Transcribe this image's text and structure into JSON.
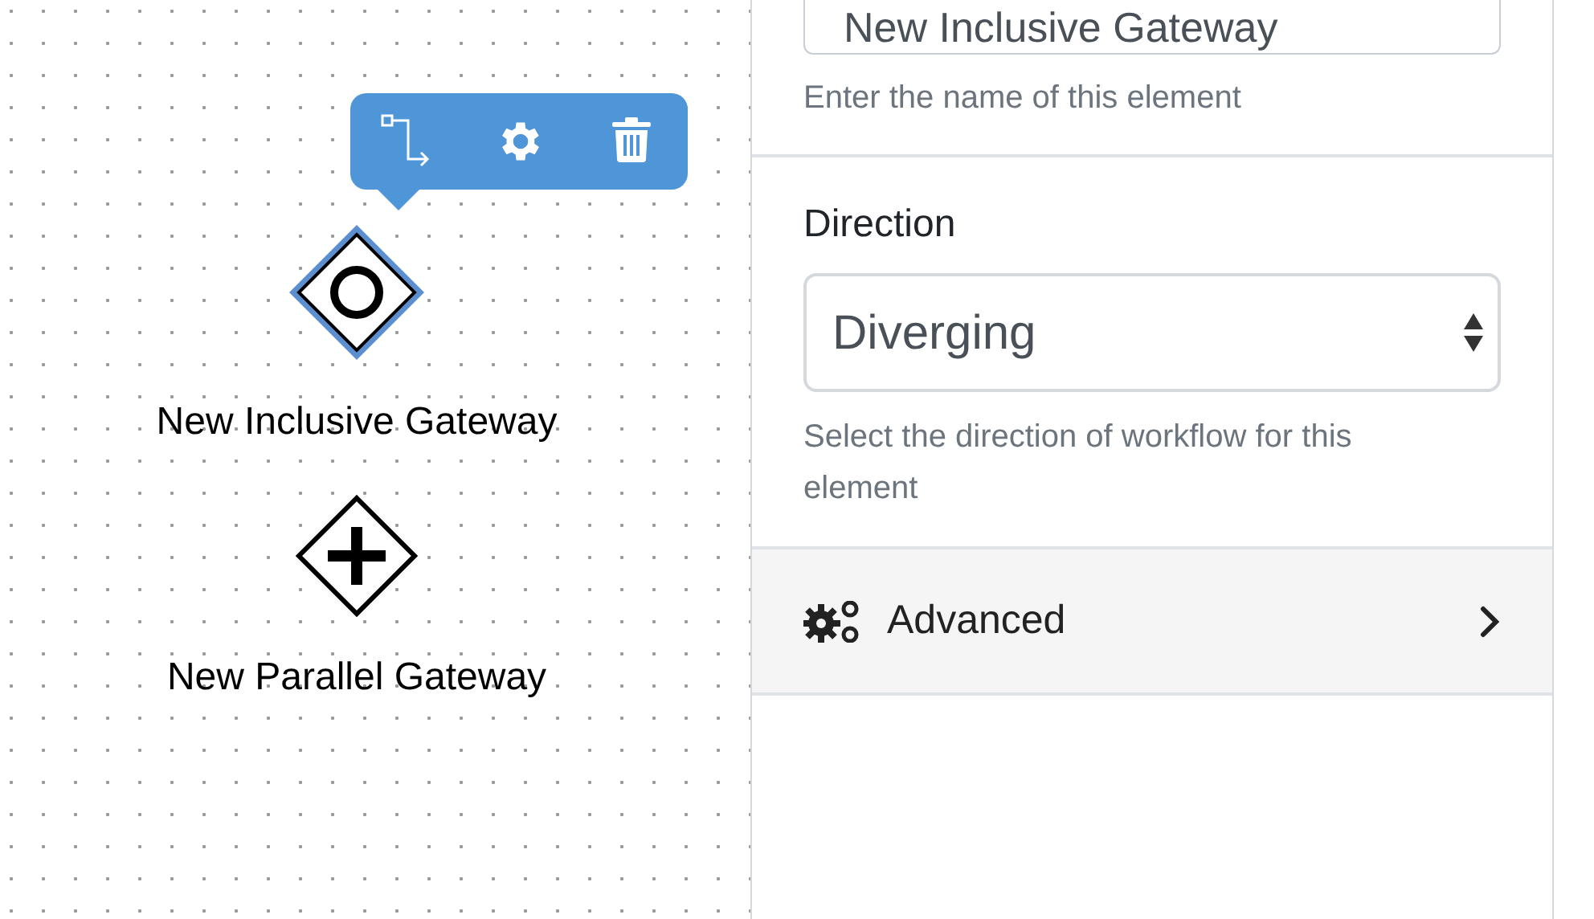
{
  "canvas": {
    "nodes": [
      {
        "kind": "inclusive",
        "label": "New Inclusive Gateway",
        "selected": true
      },
      {
        "kind": "parallel",
        "label": "New Parallel Gateway",
        "selected": false
      }
    ]
  },
  "properties": {
    "name": {
      "value": "New Inclusive Gateway",
      "hint": "Enter the name of this element"
    },
    "direction": {
      "label": "Direction",
      "value": "Diverging",
      "hint": "Select the direction of workflow for this element"
    },
    "advanced": {
      "label": "Advanced",
      "expanded": false
    }
  }
}
